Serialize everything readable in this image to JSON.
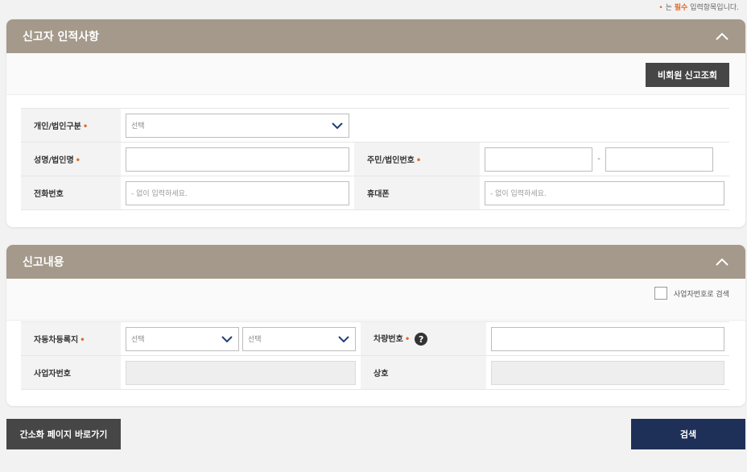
{
  "required_note": {
    "dot": "•",
    "text_pre": " 는 ",
    "text_strong": "필수",
    "text_post": " 입력항목입니다."
  },
  "reporter_section": {
    "title": "신고자 인적사항",
    "lookup_button": "비회원 신고조회",
    "fields": {
      "type_label": "개인/법인구분",
      "type_select_value": "선택",
      "name_label": "성명/법인명",
      "name_value": "",
      "id_label": "주민/법인번호",
      "id_part1": "",
      "id_separator": "-",
      "id_part2": "",
      "phone_label": "전화번호",
      "phone_placeholder": "- 없이 입력하세요.",
      "mobile_label": "휴대폰",
      "mobile_placeholder": "- 없이 입력하세요."
    }
  },
  "report_section": {
    "title": "신고내용",
    "checkbox_label": "사업자번호로 검색",
    "fields": {
      "registration_label": "자동차등록지",
      "registration_select1": "선택",
      "registration_select2": "선택",
      "vehicle_no_label": "차량번호",
      "vehicle_no_value": "",
      "help_symbol": "?",
      "business_no_label": "사업자번호",
      "business_no_value": "",
      "company_label": "상호",
      "company_value": ""
    }
  },
  "required_mark": "•",
  "footer": {
    "simple_page_button": "간소화 페이지 바로가기",
    "search_button": "검색"
  },
  "colors": {
    "header": "#a4998a",
    "accent": "#e06a2b",
    "primary_button": "#1f3058",
    "dark_button": "#464646"
  }
}
